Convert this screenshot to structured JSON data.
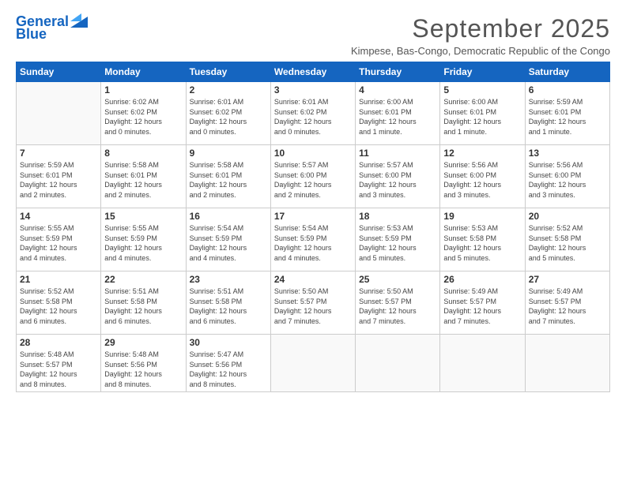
{
  "logo": {
    "line1": "General",
    "line2": "Blue"
  },
  "title": "September 2025",
  "subtitle": "Kimpese, Bas-Congo, Democratic Republic of the Congo",
  "days_of_week": [
    "Sunday",
    "Monday",
    "Tuesday",
    "Wednesday",
    "Thursday",
    "Friday",
    "Saturday"
  ],
  "weeks": [
    [
      {
        "day": "",
        "info": ""
      },
      {
        "day": "1",
        "info": "Sunrise: 6:02 AM\nSunset: 6:02 PM\nDaylight: 12 hours\nand 0 minutes."
      },
      {
        "day": "2",
        "info": "Sunrise: 6:01 AM\nSunset: 6:02 PM\nDaylight: 12 hours\nand 0 minutes."
      },
      {
        "day": "3",
        "info": "Sunrise: 6:01 AM\nSunset: 6:02 PM\nDaylight: 12 hours\nand 0 minutes."
      },
      {
        "day": "4",
        "info": "Sunrise: 6:00 AM\nSunset: 6:01 PM\nDaylight: 12 hours\nand 1 minute."
      },
      {
        "day": "5",
        "info": "Sunrise: 6:00 AM\nSunset: 6:01 PM\nDaylight: 12 hours\nand 1 minute."
      },
      {
        "day": "6",
        "info": "Sunrise: 5:59 AM\nSunset: 6:01 PM\nDaylight: 12 hours\nand 1 minute."
      }
    ],
    [
      {
        "day": "7",
        "info": "Sunrise: 5:59 AM\nSunset: 6:01 PM\nDaylight: 12 hours\nand 2 minutes."
      },
      {
        "day": "8",
        "info": "Sunrise: 5:58 AM\nSunset: 6:01 PM\nDaylight: 12 hours\nand 2 minutes."
      },
      {
        "day": "9",
        "info": "Sunrise: 5:58 AM\nSunset: 6:01 PM\nDaylight: 12 hours\nand 2 minutes."
      },
      {
        "day": "10",
        "info": "Sunrise: 5:57 AM\nSunset: 6:00 PM\nDaylight: 12 hours\nand 2 minutes."
      },
      {
        "day": "11",
        "info": "Sunrise: 5:57 AM\nSunset: 6:00 PM\nDaylight: 12 hours\nand 3 minutes."
      },
      {
        "day": "12",
        "info": "Sunrise: 5:56 AM\nSunset: 6:00 PM\nDaylight: 12 hours\nand 3 minutes."
      },
      {
        "day": "13",
        "info": "Sunrise: 5:56 AM\nSunset: 6:00 PM\nDaylight: 12 hours\nand 3 minutes."
      }
    ],
    [
      {
        "day": "14",
        "info": "Sunrise: 5:55 AM\nSunset: 5:59 PM\nDaylight: 12 hours\nand 4 minutes."
      },
      {
        "day": "15",
        "info": "Sunrise: 5:55 AM\nSunset: 5:59 PM\nDaylight: 12 hours\nand 4 minutes."
      },
      {
        "day": "16",
        "info": "Sunrise: 5:54 AM\nSunset: 5:59 PM\nDaylight: 12 hours\nand 4 minutes."
      },
      {
        "day": "17",
        "info": "Sunrise: 5:54 AM\nSunset: 5:59 PM\nDaylight: 12 hours\nand 4 minutes."
      },
      {
        "day": "18",
        "info": "Sunrise: 5:53 AM\nSunset: 5:59 PM\nDaylight: 12 hours\nand 5 minutes."
      },
      {
        "day": "19",
        "info": "Sunrise: 5:53 AM\nSunset: 5:58 PM\nDaylight: 12 hours\nand 5 minutes."
      },
      {
        "day": "20",
        "info": "Sunrise: 5:52 AM\nSunset: 5:58 PM\nDaylight: 12 hours\nand 5 minutes."
      }
    ],
    [
      {
        "day": "21",
        "info": "Sunrise: 5:52 AM\nSunset: 5:58 PM\nDaylight: 12 hours\nand 6 minutes."
      },
      {
        "day": "22",
        "info": "Sunrise: 5:51 AM\nSunset: 5:58 PM\nDaylight: 12 hours\nand 6 minutes."
      },
      {
        "day": "23",
        "info": "Sunrise: 5:51 AM\nSunset: 5:58 PM\nDaylight: 12 hours\nand 6 minutes."
      },
      {
        "day": "24",
        "info": "Sunrise: 5:50 AM\nSunset: 5:57 PM\nDaylight: 12 hours\nand 7 minutes."
      },
      {
        "day": "25",
        "info": "Sunrise: 5:50 AM\nSunset: 5:57 PM\nDaylight: 12 hours\nand 7 minutes."
      },
      {
        "day": "26",
        "info": "Sunrise: 5:49 AM\nSunset: 5:57 PM\nDaylight: 12 hours\nand 7 minutes."
      },
      {
        "day": "27",
        "info": "Sunrise: 5:49 AM\nSunset: 5:57 PM\nDaylight: 12 hours\nand 7 minutes."
      }
    ],
    [
      {
        "day": "28",
        "info": "Sunrise: 5:48 AM\nSunset: 5:57 PM\nDaylight: 12 hours\nand 8 minutes."
      },
      {
        "day": "29",
        "info": "Sunrise: 5:48 AM\nSunset: 5:56 PM\nDaylight: 12 hours\nand 8 minutes."
      },
      {
        "day": "30",
        "info": "Sunrise: 5:47 AM\nSunset: 5:56 PM\nDaylight: 12 hours\nand 8 minutes."
      },
      {
        "day": "",
        "info": ""
      },
      {
        "day": "",
        "info": ""
      },
      {
        "day": "",
        "info": ""
      },
      {
        "day": "",
        "info": ""
      }
    ]
  ]
}
